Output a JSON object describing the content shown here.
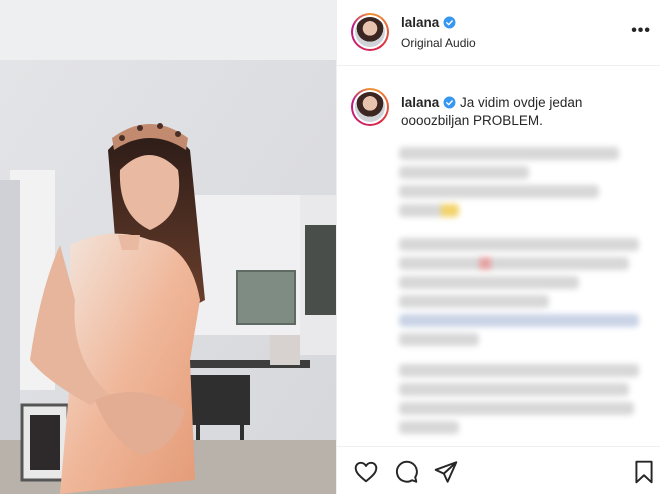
{
  "post": {
    "username": "lalana",
    "verified": true,
    "audio": "Original Audio"
  },
  "caption": {
    "username": "lalana",
    "text": "Ja vidim ovdje jedan oooozbiljan PROBLEM."
  },
  "icons": {
    "more": "more-options-icon",
    "like": "heart-icon",
    "comment": "comment-icon",
    "share": "paper-plane-icon",
    "save": "bookmark-icon"
  },
  "colors": {
    "verified_badge": "#3897f0",
    "divider": "#efefef"
  }
}
